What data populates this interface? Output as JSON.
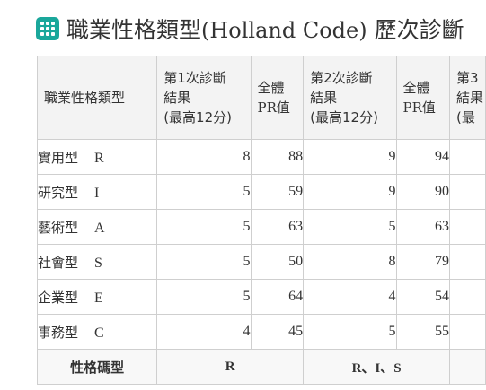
{
  "title": {
    "icon": "grid-icon",
    "icon_color": "#1aa79b",
    "text_cjk_1": "職業性格類型",
    "text_latin": "(Holland Code)",
    "text_cjk_2": "歷次診斷"
  },
  "table": {
    "header": {
      "type_col": "職業性格類型",
      "diag1_line1": "第1次診斷",
      "diag1_line2": "結果",
      "diag1_line3": "(最高12分)",
      "pr1_line1": "全體",
      "pr1_line2": "PR值",
      "diag2_line1": "第2次診斷",
      "diag2_line2": "結果",
      "diag2_line3": "(最高12分)",
      "pr2_line1": "全體",
      "pr2_line2": "PR值",
      "diag3_line1": "第3",
      "diag3_line2": "結果",
      "diag3_line3": "(最"
    },
    "rows": [
      {
        "type": "實用型",
        "code": "R",
        "score1": "8",
        "pr1": "88",
        "score2": "9",
        "pr2": "94"
      },
      {
        "type": "研究型",
        "code": "I",
        "score1": "5",
        "pr1": "59",
        "score2": "9",
        "pr2": "90"
      },
      {
        "type": "藝術型",
        "code": "A",
        "score1": "5",
        "pr1": "63",
        "score2": "5",
        "pr2": "63"
      },
      {
        "type": "社會型",
        "code": "S",
        "score1": "5",
        "pr1": "50",
        "score2": "8",
        "pr2": "79"
      },
      {
        "type": "企業型",
        "code": "E",
        "score1": "5",
        "pr1": "64",
        "score2": "4",
        "pr2": "54"
      },
      {
        "type": "事務型",
        "code": "C",
        "score1": "4",
        "pr1": "45",
        "score2": "5",
        "pr2": "55"
      }
    ],
    "footer": {
      "label": "性格碼型",
      "code1": "R",
      "code2": "R、I、S"
    }
  }
}
